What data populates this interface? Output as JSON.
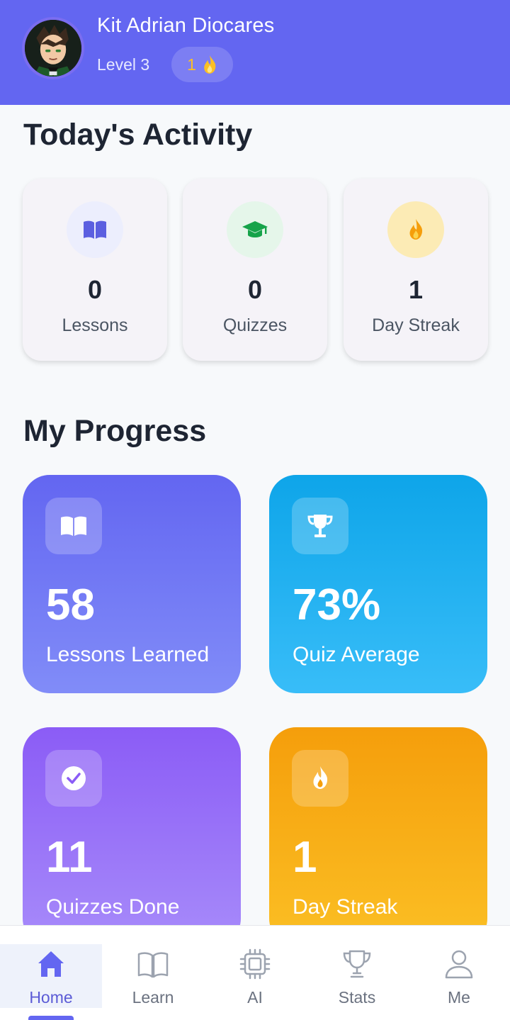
{
  "header": {
    "user_name": "Kit Adrian Diocares",
    "level": "Level 3",
    "streak_count": "1",
    "streak_icon": "flame-icon",
    "background_color": "#6366f1"
  },
  "activity": {
    "title": "Today's Activity",
    "cards": [
      {
        "value": "0",
        "label": "Lessons",
        "icon": "book-icon",
        "icon_color": "#5b5fe0",
        "icon_bg": "#eceefd"
      },
      {
        "value": "0",
        "label": "Quizzes",
        "icon": "graduation-cap-icon",
        "icon_color": "#16a34a",
        "icon_bg": "#e5f6ea"
      },
      {
        "value": "1",
        "label": "Day Streak",
        "icon": "flame-icon",
        "icon_color": "#f59e0b",
        "icon_bg": "#fcebb5"
      }
    ]
  },
  "progress": {
    "title": "My Progress",
    "cards": [
      {
        "value": "58",
        "label": "Lessons Learned",
        "icon": "book-icon",
        "gradient": [
          "#6366f1",
          "#818cf8"
        ]
      },
      {
        "value": "73%",
        "label": "Quiz Average",
        "icon": "trophy-icon",
        "gradient": [
          "#0ea5e9",
          "#38bdf8"
        ]
      },
      {
        "value": "11",
        "label": "Quizzes Done",
        "icon": "check-circle-icon",
        "gradient": [
          "#8b5cf6",
          "#a78bfa"
        ]
      },
      {
        "value": "1",
        "label": "Day Streak",
        "icon": "flame-icon",
        "gradient": [
          "#f59e0b",
          "#fbbf24"
        ]
      }
    ]
  },
  "nav": {
    "active_color": "#6366f1",
    "items": [
      {
        "label": "Home",
        "icon": "home-icon",
        "active": true
      },
      {
        "label": "Learn",
        "icon": "book-open-icon",
        "active": false
      },
      {
        "label": "AI",
        "icon": "chip-icon",
        "active": false
      },
      {
        "label": "Stats",
        "icon": "trophy-icon",
        "active": false
      },
      {
        "label": "Me",
        "icon": "user-icon",
        "active": false
      }
    ]
  }
}
